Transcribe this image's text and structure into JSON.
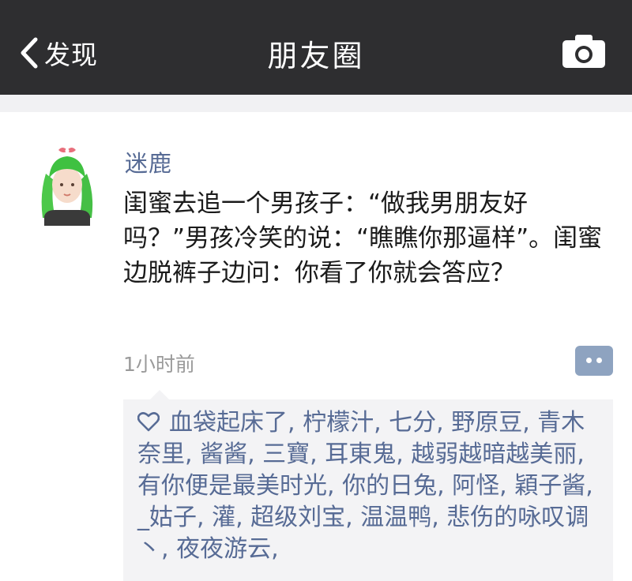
{
  "navbar": {
    "back_label": "发现",
    "title": "朋友圈"
  },
  "post": {
    "author": "迷鹿",
    "text": "闺蜜去追一个男孩子：“做我男朋友好吗？”男孩冷笑的说：“瞧瞧你那逼样”。闺蜜边脱裤子边问：你看了你就会答应？",
    "time": "1小时前"
  },
  "likes": {
    "names": "血袋起床了, 柠檬汁, 七分, 野原豆, 青木奈里, 酱酱, 三寶, 耳東鬼, 越弱越暗越美丽, 有你便是最美时光, 你的日兔, 阿怪, 穎子酱, _姑子, 灌, 超级刘宝, 温温鸭, 悲伤的咏叹调丶, 夜夜游云,"
  },
  "colors": {
    "navbar_bg": "#2e2e30",
    "link_blue": "#576b95",
    "likes_bg": "#f3f3f5",
    "comment_button": "#8ea3c0"
  },
  "icons": {
    "back": "chevron-left-icon",
    "camera": "camera-icon",
    "like": "heart-outline-icon",
    "comment": "comment-dots-icon"
  }
}
